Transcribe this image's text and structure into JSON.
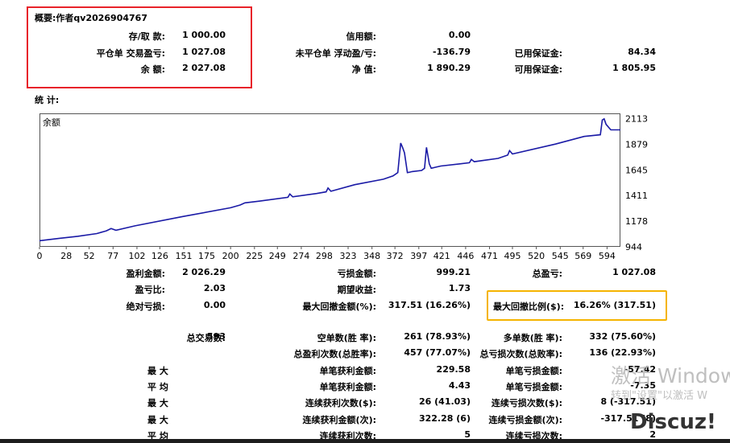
{
  "summary": {
    "title": "概要:作者qv2026904767",
    "rows": [
      [
        {
          "label": "存/取 款:",
          "value": "1 000.00"
        },
        {
          "label": "信用额:",
          "value": "0.00"
        },
        {
          "label": "",
          "value": ""
        }
      ],
      [
        {
          "label": "平仓单 交易盈亏:",
          "value": "1 027.08"
        },
        {
          "label": "未平仓单 浮动盈/亏:",
          "value": "-136.79"
        },
        {
          "label": "已用保证金:",
          "value": "84.34"
        }
      ],
      [
        {
          "label": "余 额:",
          "value": "2 027.08"
        },
        {
          "label": "净 值:",
          "value": "1 890.29"
        },
        {
          "label": "可用保证金:",
          "value": "1 805.95"
        }
      ]
    ]
  },
  "stats_title": "统 计:",
  "chart_data": {
    "type": "line",
    "legend": "余额",
    "x_ticks": [
      0,
      28,
      52,
      77,
      102,
      126,
      151,
      175,
      200,
      225,
      249,
      274,
      298,
      323,
      348,
      372,
      397,
      421,
      446,
      471,
      495,
      520,
      545,
      569,
      594
    ],
    "y_ticks": [
      944,
      1178,
      1411,
      1645,
      1879,
      2113
    ],
    "xlim": [
      0,
      608
    ],
    "ylim": [
      944,
      2160
    ],
    "color": "#1a1aa6",
    "series": [
      {
        "x": [
          0,
          20,
          40,
          60,
          70,
          75,
          80,
          100,
          150,
          200,
          210,
          215,
          230,
          260,
          262,
          265,
          290,
          300,
          302,
          305,
          330,
          360,
          370,
          375,
          378,
          380,
          382,
          385,
          388,
          390,
          400,
          403,
          405,
          408,
          410,
          415,
          420,
          440,
          450,
          452,
          455,
          480,
          490,
          492,
          495,
          540,
          570,
          587,
          589,
          591,
          593,
          598,
          608
        ],
        "y": [
          1000,
          1020,
          1040,
          1065,
          1090,
          1110,
          1095,
          1135,
          1220,
          1300,
          1325,
          1345,
          1360,
          1395,
          1425,
          1400,
          1430,
          1445,
          1480,
          1450,
          1510,
          1560,
          1590,
          1620,
          1890,
          1850,
          1800,
          1620,
          1625,
          1630,
          1640,
          1660,
          1850,
          1700,
          1660,
          1670,
          1680,
          1700,
          1710,
          1740,
          1720,
          1750,
          1780,
          1820,
          1790,
          1880,
          1950,
          1965,
          2100,
          2110,
          2060,
          2010,
          2010
        ]
      }
    ]
  },
  "stats": {
    "r1": [
      {
        "label": "盈利金额:",
        "value": "2 026.29"
      },
      {
        "label": "亏损金额:",
        "value": "999.21"
      },
      {
        "label": "总盈亏:",
        "value": "1 027.08"
      }
    ],
    "r2": [
      {
        "label": "盈亏比:",
        "value": "2.03"
      },
      {
        "label": "期望收益:",
        "value": "1.73"
      }
    ],
    "r3": [
      {
        "label": "绝对亏损:",
        "value": "0.00"
      },
      {
        "label": "最大回撤金额(%):",
        "value": "317.51 (16.26%)"
      },
      {
        "label": "最大回撤比例($):",
        "value": "16.26% (317.51)"
      }
    ],
    "r4": [
      {
        "label": "总交易数:",
        "value": "593"
      },
      {
        "label": "空单数(胜 率):",
        "value": "261 (78.93%)"
      },
      {
        "label": "多单数(胜 率):",
        "value": "332 (75.60%)"
      }
    ],
    "r5": [
      {
        "label": "总盈利次数(总胜率):",
        "value": "457 (77.07%)"
      },
      {
        "label": "总亏损次数(总败率):",
        "value": "136 (22.93%)"
      }
    ],
    "r6": [
      {
        "label": "最 大",
        "value": ""
      },
      {
        "label": "单笔获利金额:",
        "value": "229.58"
      },
      {
        "label": "单笔亏损金额:",
        "value": "-57.42"
      }
    ],
    "r7": [
      {
        "label": "平 均",
        "value": ""
      },
      {
        "label": "单笔获利金额:",
        "value": "4.43"
      },
      {
        "label": "单笔亏损金额:",
        "value": "-7.35"
      }
    ],
    "r8": [
      {
        "label": "最 大",
        "value": ""
      },
      {
        "label": "连续获利次数($):",
        "value": "26 (41.03)"
      },
      {
        "label": "连续亏损次数($):",
        "value": "8 (-317.51)"
      }
    ],
    "r9": [
      {
        "label": "最 大",
        "value": ""
      },
      {
        "label": "连续获利金额(次):",
        "value": "322.28 (6)"
      },
      {
        "label": "连续亏损金额(次):",
        "value": "-317.51 (8)"
      }
    ],
    "r10": [
      {
        "label": "平 均",
        "value": ""
      },
      {
        "label": "连续获利次数:",
        "value": "5"
      },
      {
        "label": "连续亏损次数:",
        "value": "2"
      }
    ]
  },
  "watermarks": {
    "activate_title": "激活 Windows",
    "activate_sub": "转到\"设置\"以激活 W",
    "discuz": "Discuz!"
  }
}
